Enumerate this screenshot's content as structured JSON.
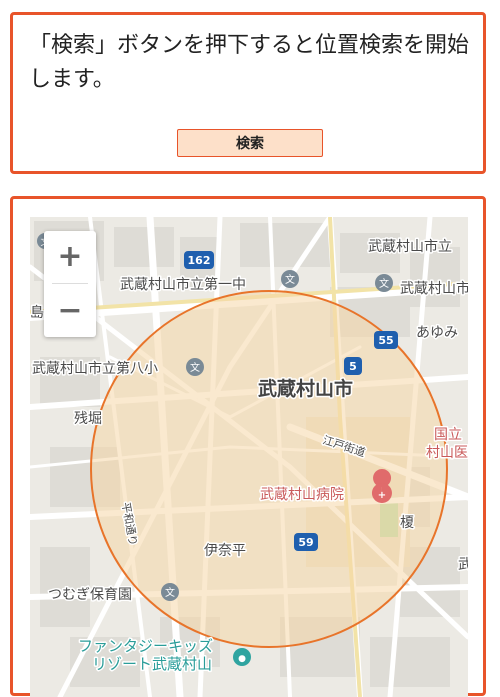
{
  "search_panel": {
    "instruction": "「検索」ボタンを押下すると位置検索を開始します。",
    "search_button_label": "検索"
  },
  "map": {
    "zoom_in_label": "+",
    "zoom_out_label": "−",
    "route_shields": [
      "162",
      "55",
      "5",
      "59"
    ],
    "labels": {
      "school_top_right": "武蔵村山市立",
      "school_daiichi": "武蔵村山市立第一中",
      "school_right": "武蔵村山市立",
      "school_left_fragment": "島立",
      "ayumi": "あゆみ",
      "school_daihachi": "武蔵村山市立第八小",
      "city": "武蔵村山市",
      "zanbori": "残堀",
      "edo_kaido": "江戸街道",
      "national_hospital": "国立",
      "murayama_medical": "村山医療",
      "hospital": "武蔵村山病院",
      "heiwa_dori": "平和通り",
      "inadaira": "伊奈平",
      "yoko_fragment": "榎",
      "right_edge_fragment": "武",
      "nursery": "つむぎ保育園",
      "fantasy_line1": "ファンタジーキッズ",
      "fantasy_line2": "リゾート武蔵村山"
    },
    "icons": [
      "school-icon",
      "hospital-icon",
      "shopping-icon"
    ],
    "colors": {
      "search_circle_stroke": "#e8742a",
      "search_circle_fill": "#f6d7a8",
      "panel_border": "#e8542a",
      "shield_blue": "#1f5fae"
    }
  }
}
